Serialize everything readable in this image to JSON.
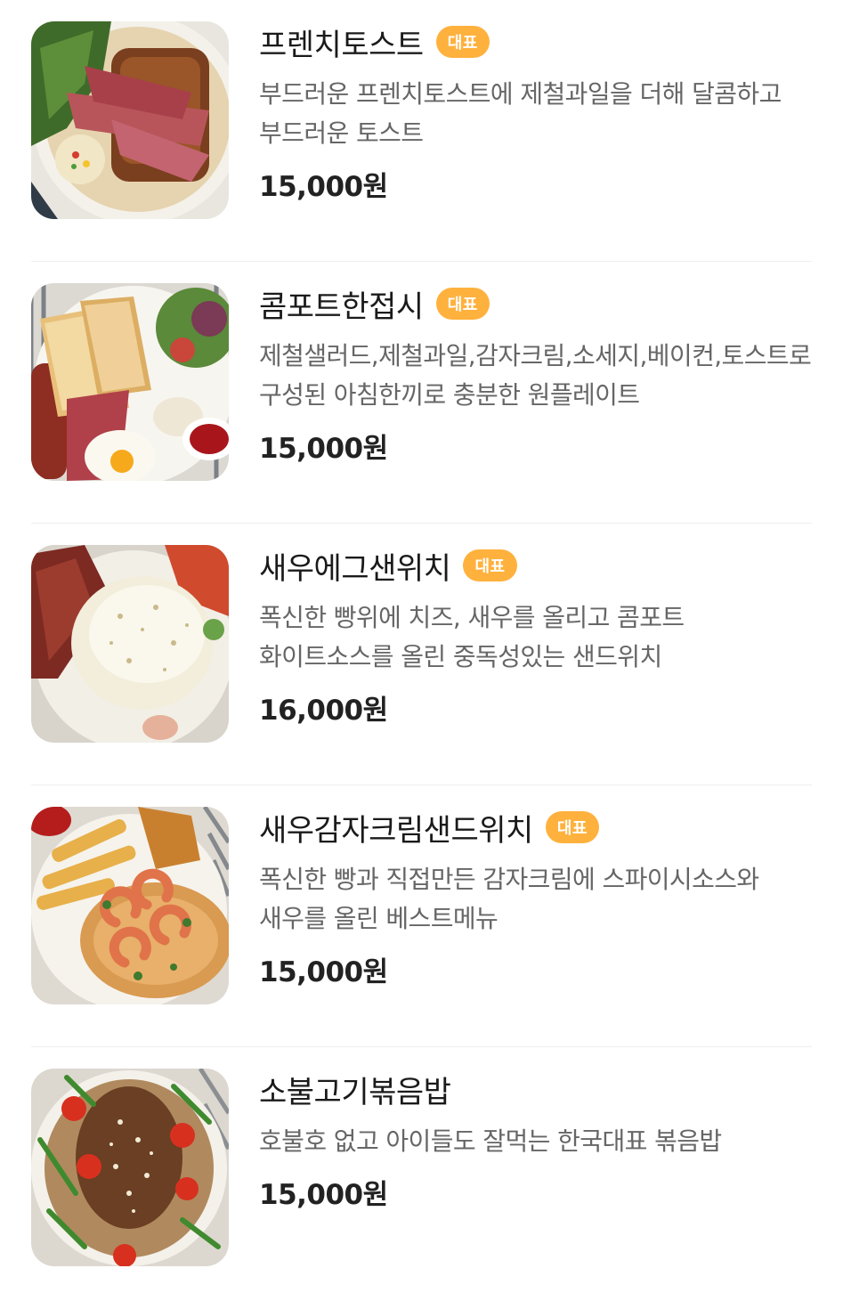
{
  "menu": {
    "items": [
      {
        "name": "프렌치토스트",
        "badge": "대표",
        "description": "부드러운 프렌치토스트에 제철과일을 더해 달콤하고 부드러운 토스트",
        "price": "15,000원",
        "photo": "french-toast-photo"
      },
      {
        "name": "콤포트한접시",
        "badge": "대표",
        "description": "제철샐러드,제철과일,감자크림,소세지,베이컨,토스트로 구성된 아침한끼로 충분한 원플레이트",
        "price": "15,000원",
        "photo": "compote-plate-photo"
      },
      {
        "name": "새우에그샌위치",
        "badge": "대표",
        "description": "폭신한 빵위에 치즈, 새우를 올리고 콤포트 화이트소스를 올린 중독성있는 샌드위치",
        "price": "16,000원",
        "photo": "shrimp-egg-sandwich-photo"
      },
      {
        "name": "새우감자크림샌드위치",
        "badge": "대표",
        "description": "폭신한 빵과 직접만든 감자크림에 스파이시소스와 새우를 올린 베스트메뉴",
        "price": "15,000원",
        "photo": "shrimp-potato-cream-sandwich-photo"
      },
      {
        "name": "소불고기볶음밥",
        "description": "호불호 없고 아이들도 잘먹는 한국대표 볶음밥",
        "price": "15,000원",
        "photo": "beef-bulgogi-fried-rice-photo"
      }
    ]
  },
  "colors": {
    "badge": "#ffb13d",
    "title": "#1a1a1a",
    "description": "#666666",
    "price": "#222222",
    "divider": "#eeeeee"
  }
}
